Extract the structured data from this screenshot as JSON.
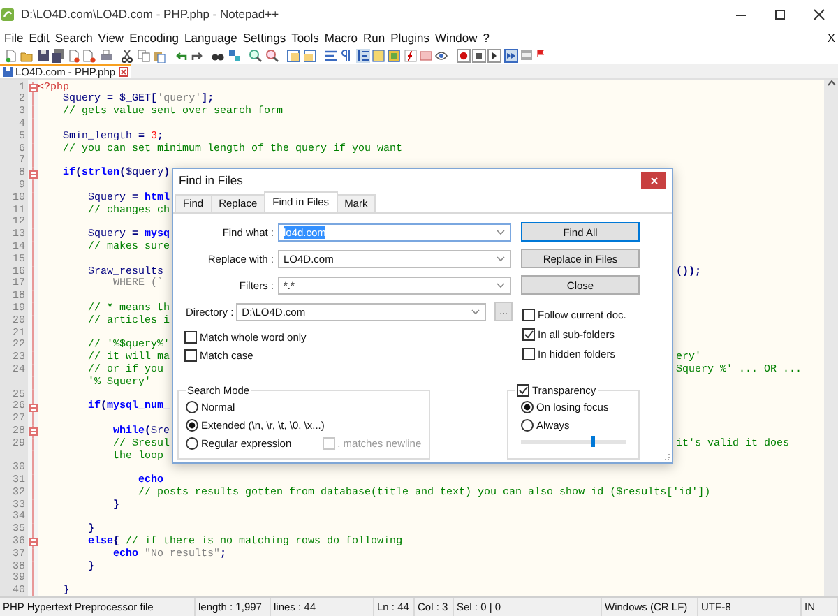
{
  "window": {
    "title": "D:\\LO4D.com\\LO4D.com - PHP.php - Notepad++"
  },
  "menu": {
    "items": [
      "File",
      "Edit",
      "Search",
      "View",
      "Encoding",
      "Language",
      "Settings",
      "Tools",
      "Macro",
      "Run",
      "Plugins",
      "Window",
      "?"
    ],
    "close": "X"
  },
  "tabs": [
    {
      "label": "LO4D.com - PHP.php",
      "selected": true
    }
  ],
  "editor": {
    "lines": [
      {
        "number": "1",
        "fold": true,
        "parts": [
          {
            "kind": "tag",
            "text": "<?php"
          }
        ]
      },
      {
        "number": "2",
        "fold": false,
        "parts": [
          {
            "kind": "var",
            "text": "    $query"
          },
          {
            "kind": "op",
            "text": " = "
          },
          {
            "kind": "var",
            "text": "$_GET"
          },
          {
            "kind": "op",
            "text": "["
          },
          {
            "kind": "str",
            "text": "'query'"
          },
          {
            "kind": "op",
            "text": "];"
          }
        ]
      },
      {
        "number": "3",
        "fold": false,
        "parts": [
          {
            "kind": "comment",
            "text": "    // gets value sent over search form"
          }
        ]
      },
      {
        "number": "4",
        "fold": false
      },
      {
        "number": "5",
        "fold": false,
        "parts": [
          {
            "kind": "var",
            "text": "    $min_length"
          },
          {
            "kind": "op",
            "text": " = "
          },
          {
            "kind": "num",
            "text": "3"
          },
          {
            "kind": "op",
            "text": ";"
          }
        ]
      },
      {
        "number": "6",
        "fold": false,
        "parts": [
          {
            "kind": "comment",
            "text": "    // you can set minimum length of the query if you want"
          }
        ]
      },
      {
        "number": "7",
        "fold": false
      },
      {
        "number": "8",
        "fold": true,
        "parts": [
          {
            "kind": "kw",
            "text": "    if"
          },
          {
            "kind": "op",
            "text": "("
          },
          {
            "kind": "kw",
            "text": "strlen"
          },
          {
            "kind": "op",
            "text": "("
          },
          {
            "kind": "var",
            "text": "$query"
          },
          {
            "kind": "op",
            "text": ")"
          }
        ]
      },
      {
        "number": "9",
        "fold": false
      },
      {
        "number": "10",
        "fold": false,
        "parts": [
          {
            "kind": "var",
            "text": "        $query"
          },
          {
            "kind": "op",
            "text": " = "
          },
          {
            "kind": "kw",
            "text": "html"
          }
        ]
      },
      {
        "number": "11",
        "fold": false,
        "parts": [
          {
            "kind": "comment",
            "text": "        // changes ch"
          }
        ]
      },
      {
        "number": "12",
        "fold": false
      },
      {
        "number": "13",
        "fold": false,
        "parts": [
          {
            "kind": "var",
            "text": "        $query"
          },
          {
            "kind": "op",
            "text": " = "
          },
          {
            "kind": "kw",
            "text": "mysq"
          }
        ]
      },
      {
        "number": "14",
        "fold": false,
        "parts": [
          {
            "kind": "comment",
            "text": "        // makes sure"
          }
        ]
      },
      {
        "number": "15",
        "fold": false
      },
      {
        "number": "16",
        "fold": false,
        "parts": [
          {
            "kind": "var",
            "text": "        $raw_results"
          }
        ],
        "right": [
          {
            "kind": "op",
            "text": "());"
          }
        ]
      },
      {
        "number": "17",
        "fold": false,
        "parts": [
          {
            "kind": "str",
            "text": "            WHERE (`"
          }
        ]
      },
      {
        "number": "18",
        "fold": false
      },
      {
        "number": "19",
        "fold": false,
        "parts": [
          {
            "kind": "comment",
            "text": "        // * means th"
          }
        ]
      },
      {
        "number": "20",
        "fold": false,
        "parts": [
          {
            "kind": "comment",
            "text": "        // articles i"
          }
        ]
      },
      {
        "number": "21",
        "fold": false
      },
      {
        "number": "22",
        "fold": false,
        "parts": [
          {
            "kind": "comment",
            "text": "        // '%$query%'"
          }
        ]
      },
      {
        "number": "23",
        "fold": false,
        "parts": [
          {
            "kind": "comment",
            "text": "        // it will ma"
          }
        ],
        "right": [
          {
            "kind": "comment",
            "text": "ery'"
          }
        ]
      },
      {
        "number": "24",
        "fold": false,
        "parts": [
          {
            "kind": "comment",
            "text": "        // or if you"
          }
        ],
        "right": [
          {
            "kind": "comment",
            "text": "$query %' ... OR ..."
          }
        ],
        "wrap": [
          {
            "kind": "comment",
            "text": "        '% $query'"
          }
        ]
      },
      {
        "number": "25",
        "fold": false
      },
      {
        "number": "26",
        "fold": true,
        "parts": [
          {
            "kind": "kw",
            "text": "        if"
          },
          {
            "kind": "op",
            "text": "("
          },
          {
            "kind": "kw",
            "text": "mysql_num_"
          }
        ]
      },
      {
        "number": "27",
        "fold": false
      },
      {
        "number": "28",
        "fold": true,
        "parts": [
          {
            "kind": "kw",
            "text": "            while"
          },
          {
            "kind": "op",
            "text": "("
          },
          {
            "kind": "var",
            "text": "$re"
          }
        ]
      },
      {
        "number": "29",
        "fold": false,
        "parts": [
          {
            "kind": "comment",
            "text": "            // $resul"
          }
        ],
        "right": [
          {
            "kind": "comment",
            "text": "it's valid it does"
          }
        ],
        "wrap": [
          {
            "kind": "comment",
            "text": "            the loop"
          }
        ]
      },
      {
        "number": "30",
        "fold": false
      },
      {
        "number": "31",
        "fold": false,
        "parts": [
          {
            "kind": "kw",
            "text": "                echo"
          }
        ]
      },
      {
        "number": "32",
        "fold": false,
        "parts": [
          {
            "kind": "comment",
            "text": "                // posts results gotten from database(title and text) you can also show id ($results['id'])"
          }
        ]
      },
      {
        "number": "33",
        "fold": false,
        "parts": [
          {
            "kind": "op",
            "text": "            }"
          }
        ]
      },
      {
        "number": "34",
        "fold": false
      },
      {
        "number": "35",
        "fold": false,
        "parts": [
          {
            "kind": "op",
            "text": "        }"
          }
        ]
      },
      {
        "number": "36",
        "fold": true,
        "parts": [
          {
            "kind": "kw",
            "text": "        else"
          },
          {
            "kind": "op",
            "text": "{ "
          },
          {
            "kind": "comment",
            "text": "// if there is no matching rows do following"
          }
        ]
      },
      {
        "number": "37",
        "fold": false,
        "parts": [
          {
            "kind": "kw",
            "text": "            echo "
          },
          {
            "kind": "str",
            "text": "\"No results\""
          },
          {
            "kind": "op",
            "text": ";"
          }
        ]
      },
      {
        "number": "38",
        "fold": false,
        "parts": [
          {
            "kind": "op",
            "text": "        }"
          }
        ]
      },
      {
        "number": "39",
        "fold": false
      },
      {
        "number": "40",
        "fold": false,
        "parts": [
          {
            "kind": "op",
            "text": "    }"
          }
        ]
      }
    ]
  },
  "find_dialog": {
    "title": "Find in Files",
    "tabs": [
      {
        "label": "Find",
        "selected": false
      },
      {
        "label": "Replace",
        "selected": false
      },
      {
        "label": "Find in Files",
        "selected": true
      },
      {
        "label": "Mark",
        "selected": false
      }
    ],
    "fields": [
      {
        "label": "Find what :",
        "value": "lo4d.com",
        "text_selected": true
      },
      {
        "label": "Replace with :",
        "value": "LO4D.com",
        "text_selected": false
      },
      {
        "label": "Filters :",
        "value": "*.*",
        "text_selected": false
      }
    ],
    "directory": {
      "label": "Directory :",
      "value": "D:\\LO4D.com",
      "browse": "..."
    },
    "options": [
      {
        "label": "Match whole word only",
        "checked": false
      },
      {
        "label": "Match case",
        "checked": false
      }
    ],
    "buttons": [
      {
        "label": "Find All",
        "default": true
      },
      {
        "label": "Replace in Files",
        "default": false
      },
      {
        "label": "Close",
        "default": false
      }
    ],
    "folder_options": [
      {
        "label": "Follow current doc.",
        "checked": false
      },
      {
        "label": "In all sub-folders",
        "checked": true
      },
      {
        "label": "In hidden folders",
        "checked": false
      }
    ],
    "search_mode": {
      "title": "Search Mode",
      "modes": [
        {
          "label": "Normal",
          "selected": false
        },
        {
          "label": "Extended (\\n, \\r, \\t, \\0, \\x...)",
          "selected": true
        },
        {
          "label": "Regular expression",
          "selected": false
        }
      ],
      "dot_newline": {
        "label": ". matches newline",
        "checked": false,
        "disabled": true
      }
    },
    "transparency": {
      "label": "Transparency",
      "checked": true,
      "modes": [
        {
          "label": "On losing focus",
          "selected": true
        },
        {
          "label": "Always",
          "selected": false
        }
      ],
      "level": 0.68
    }
  },
  "status_bar": [
    "PHP Hypertext Preprocessor file",
    "length : 1,997",
    "lines : 44",
    "Ln : 44",
    "Col : 3",
    "Sel : 0 | 0",
    "Windows (CR LF)",
    "UTF-8",
    "IN"
  ]
}
